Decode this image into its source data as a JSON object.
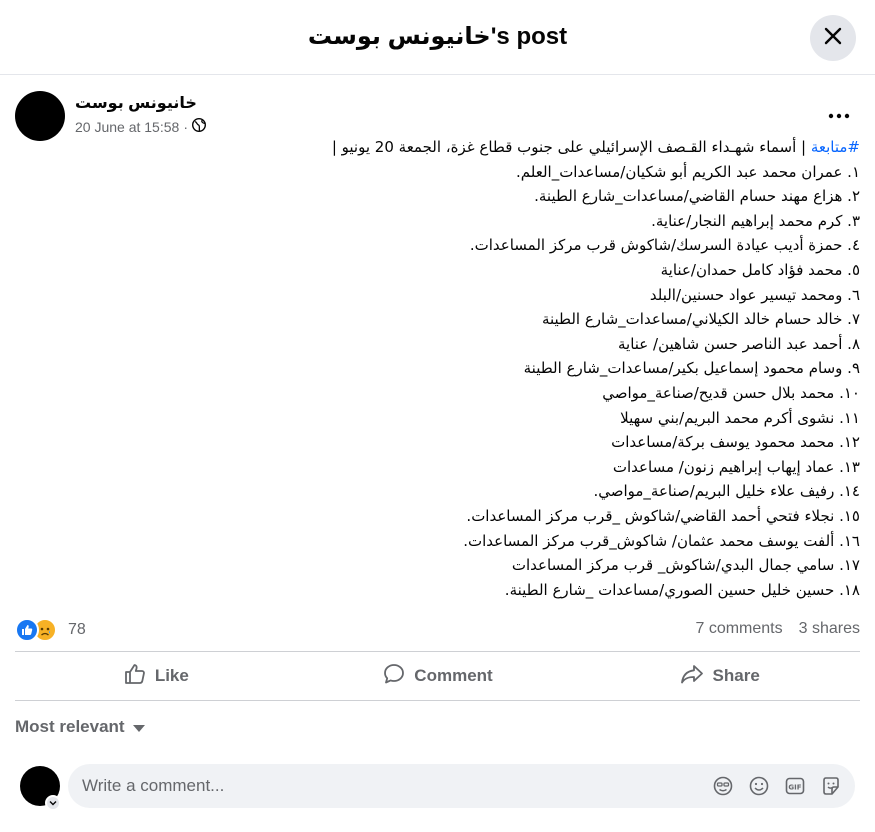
{
  "header": {
    "title": "خانيونس بوست's post"
  },
  "post": {
    "author": "خانيونس بوست",
    "timestamp": "20 June at 15:58",
    "separator": "·",
    "hashtag": "#متابعة",
    "headline_rest": " | أسماء شهـداء القـصف الإسرائيلي على جنوب قطاع غزة، الجمعة 20 يونيو |",
    "lines": [
      "١. عمران محمد عبد الكريم أبو شكيان/مساعدات_العلم.",
      "٢. هزاع مهند حسام القاضي/مساعدات_شارع الطينة.",
      "٣. كرم محمد إبراهيم النجار/عناية.",
      "٤. حمزة أديب عيادة السرسك/شاكوش قرب مركز المساعدات.",
      "٥. محمد فؤاد كامل حمدان/عناية",
      "٦. ومحمد تيسير عواد حسنين/البلد",
      "٧. خالد حسام خالد الكيلاني/مساعدات_شارع الطينة",
      "٨. أحمد عبد الناصر حسن شاهين/ عناية",
      "٩. وسام محمود إسماعيل بكير/مساعدات_شارع الطينة",
      "١٠. محمد بلال حسن قديح/صناعة_مواصي",
      "١١. نشوى أكرم محمد البريم/بني سهيلا",
      "١٢. محمد محمود يوسف بركة/مساعدات",
      "١٣. عماد إيهاب إبراهيم زنون/ مساعدات",
      "١٤. رفيف علاء خليل البريم/صناعة_مواصي.",
      "١٥. نجلاء فتحي أحمد القاضي/شاكوش _قرب مركز المساعدات.",
      "١٦. ألفت يوسف محمد عثمان/ شاكوش_قرب مركز المساعدات.",
      "١٧. سامي جمال البدي/شاكوش_ قرب مركز المساعدات",
      "١٨. حسين خليل حسين الصوري/مساعدات _شارع الطينة."
    ]
  },
  "stats": {
    "reactions_count": "78",
    "comments": "7 comments",
    "shares": "3 shares"
  },
  "actions": {
    "like": "Like",
    "comment": "Comment",
    "share": "Share"
  },
  "sort": {
    "label": "Most relevant"
  },
  "composer": {
    "placeholder": "Write a comment..."
  },
  "icons": {
    "close": "close-icon",
    "globe": "globe-icon",
    "more": "more-options-icon",
    "like_reaction": "like-reaction-icon",
    "sad_reaction": "sad-reaction-icon",
    "like": "thumbs-up-icon",
    "comment": "speech-bubble-icon",
    "share": "share-arrow-icon",
    "sort_caret": "caret-down-icon",
    "avatar_chevron": "chevron-down-icon",
    "avatar_sticker": "avatar-sticker-icon",
    "emoji": "emoji-icon",
    "gif": "gif-icon",
    "sticker": "sticker-icon"
  },
  "colors": {
    "link": "#0866ff",
    "like_blue": "#1877f2",
    "sad_yellow": "#f7b125",
    "secondary_text": "#65676b",
    "input_bg": "#f0f2f5",
    "divider": "#ced0d4"
  }
}
